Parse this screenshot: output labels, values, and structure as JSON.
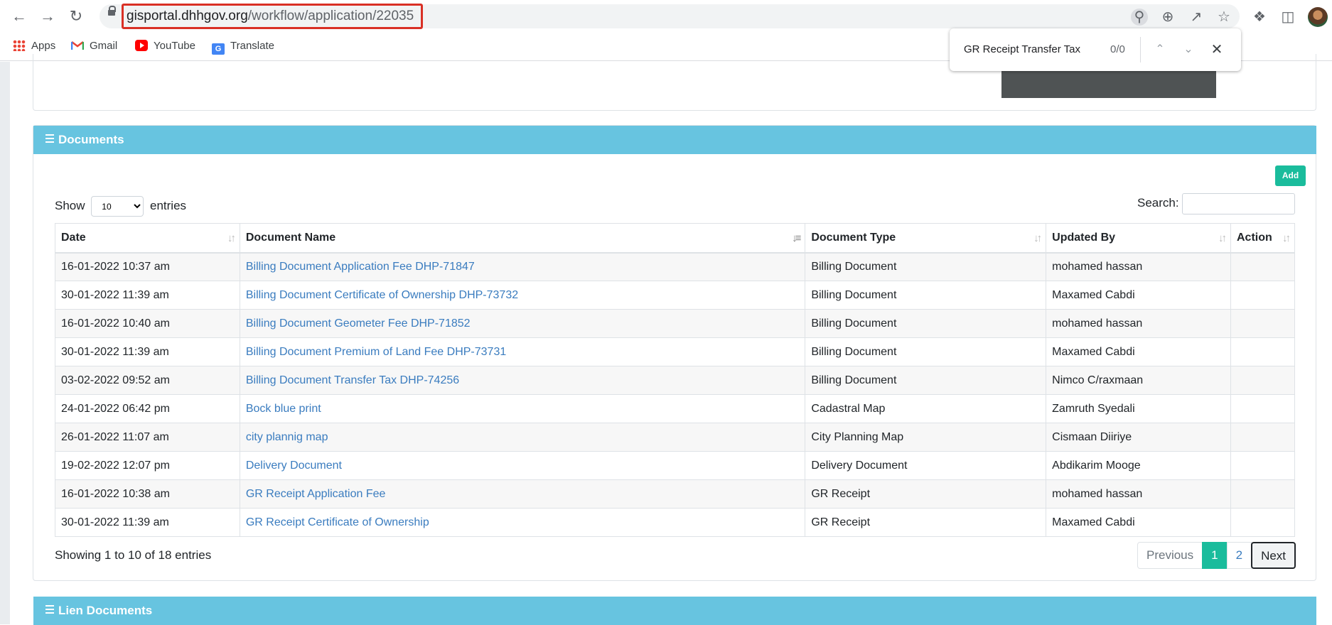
{
  "browser": {
    "url_host": "gisportal.dhhgov.org",
    "url_path": "/workflow/application/22035",
    "bookmarks": [
      "Apps",
      "Gmail",
      "YouTube",
      "Translate"
    ]
  },
  "find_bar": {
    "query": "GR Receipt Transfer Tax",
    "count": "0/0"
  },
  "documents": {
    "title": "Documents",
    "add_label": "Add",
    "show_label": "Show",
    "entries_label": "entries",
    "page_length": "10",
    "search_label": "Search:",
    "columns": [
      "Date",
      "Document Name",
      "Document Type",
      "Updated By",
      "Action"
    ],
    "rows": [
      {
        "date": "16-01-2022 10:37 am",
        "name": "Billing Document Application Fee DHP-71847",
        "type": "Billing Document",
        "by": "mohamed hassan"
      },
      {
        "date": "30-01-2022 11:39 am",
        "name": "Billing Document Certificate of Ownership DHP-73732",
        "type": "Billing Document",
        "by": "Maxamed Cabdi"
      },
      {
        "date": "16-01-2022 10:40 am",
        "name": "Billing Document Geometer Fee DHP-71852",
        "type": "Billing Document",
        "by": "mohamed hassan"
      },
      {
        "date": "30-01-2022 11:39 am",
        "name": "Billing Document Premium of Land Fee DHP-73731",
        "type": "Billing Document",
        "by": "Maxamed Cabdi"
      },
      {
        "date": "03-02-2022 09:52 am",
        "name": "Billing Document Transfer Tax DHP-74256",
        "type": "Billing Document",
        "by": "Nimco C/raxmaan"
      },
      {
        "date": "24-01-2022 06:42 pm",
        "name": "Bock blue print",
        "type": "Cadastral Map",
        "by": "Zamruth Syedali"
      },
      {
        "date": "26-01-2022 11:07 am",
        "name": "city plannig map",
        "type": "City Planning Map",
        "by": "Cismaan Diiriye"
      },
      {
        "date": "19-02-2022 12:07 pm",
        "name": "Delivery Document",
        "type": "Delivery Document",
        "by": "Abdikarim Mooge"
      },
      {
        "date": "16-01-2022 10:38 am",
        "name": "GR Receipt Application Fee",
        "type": "GR Receipt",
        "by": "mohamed hassan"
      },
      {
        "date": "30-01-2022 11:39 am",
        "name": "GR Receipt Certificate of Ownership",
        "type": "GR Receipt",
        "by": "Maxamed Cabdi"
      }
    ],
    "info": "Showing 1 to 10 of 18 entries",
    "pagination": {
      "previous": "Previous",
      "pages": [
        "1",
        "2"
      ],
      "next": "Next",
      "current": "1"
    }
  },
  "lien": {
    "title": "Lien Documents"
  },
  "colors": {
    "header_bg": "#67c4e0",
    "accent": "#1abc9c",
    "link": "#3a7cbf",
    "url_highlight": "#d93025"
  }
}
